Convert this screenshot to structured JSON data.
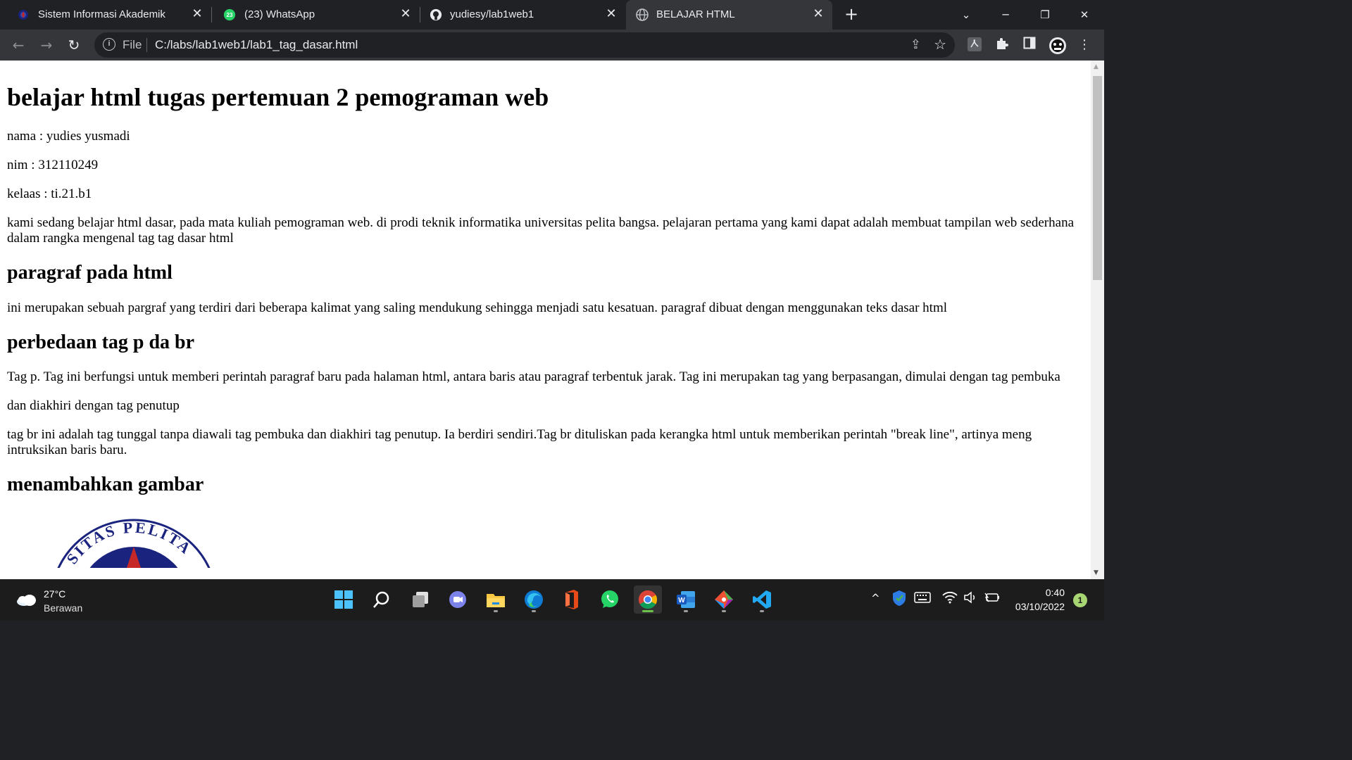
{
  "browser": {
    "tabs": [
      {
        "title": "Sistem Informasi Akademik",
        "icon": "academic-logo-icon",
        "active": false
      },
      {
        "title": "(23) WhatsApp",
        "icon": "whatsapp-icon",
        "badge": "23",
        "active": false
      },
      {
        "title": "yudiesy/lab1web1",
        "icon": "github-icon",
        "active": false
      },
      {
        "title": "BELAJAR HTML",
        "icon": "globe-icon",
        "active": true
      }
    ],
    "address": {
      "scheme": "File",
      "url": "C:/labs/lab1web1/lab1_tag_dasar.html"
    }
  },
  "page": {
    "h1": "belajar html tugas pertemuan 2 pemograman web",
    "nama": "nama : yudies yusmadi",
    "nim": "nim : 312110249",
    "kelas": "kelaas : ti.21.b1",
    "intro": "kami sedang belajar html dasar, pada mata kuliah pemograman web. di prodi teknik informatika universitas pelita bangsa. pelajaran pertama yang kami dapat adalah membuat tampilan web sederhana dalam rangka mengenal tag tag dasar html",
    "h2_paragraf": "paragraf pada html",
    "p_paragraf": "ini merupakan sebuah pargraf yang terdiri dari beberapa kalimat yang saling mendukung sehingga menjadi satu kesatuan. paragraf dibuat dengan menggunakan teks dasar html",
    "h2_perbedaan": "perbedaan tag p da br",
    "p_tag_p": "Tag p. Tag ini berfungsi untuk memberi perintah paragraf baru pada halaman html, antara baris atau paragraf terbentuk jarak. Tag ini merupakan tag yang berpasangan, dimulai dengan tag pembuka",
    "p_penutup": "dan diakhiri dengan tag penutup",
    "p_tag_br": "tag br ini adalah tag tunggal tanpa diawali tag pembuka dan diakhiri tag penutup. Ia berdiri sendiri.Tag br dituliskan pada kerangka html untuk memberikan perintah \"break line\", artinya meng intruksikan baris baru.",
    "h2_gambar": "menambahkan gambar",
    "logo_text": "SITAS PELITA"
  },
  "taskbar": {
    "weather_temp": "27°C",
    "weather_cond": "Berawan",
    "time": "0:40",
    "date": "03/10/2022",
    "notifications": "1",
    "apps": [
      "windows-start-icon",
      "search-icon",
      "task-view-icon",
      "teams-chat-icon",
      "file-explorer-icon",
      "edge-icon",
      "office-icon",
      "whatsapp-icon",
      "chrome-icon",
      "word-icon",
      "git-icon",
      "vscode-icon"
    ]
  },
  "colors": {
    "tabbar": "#202124",
    "toolbar": "#35363a",
    "page_bg": "#ffffff",
    "taskbar": "#1c1c1c"
  }
}
